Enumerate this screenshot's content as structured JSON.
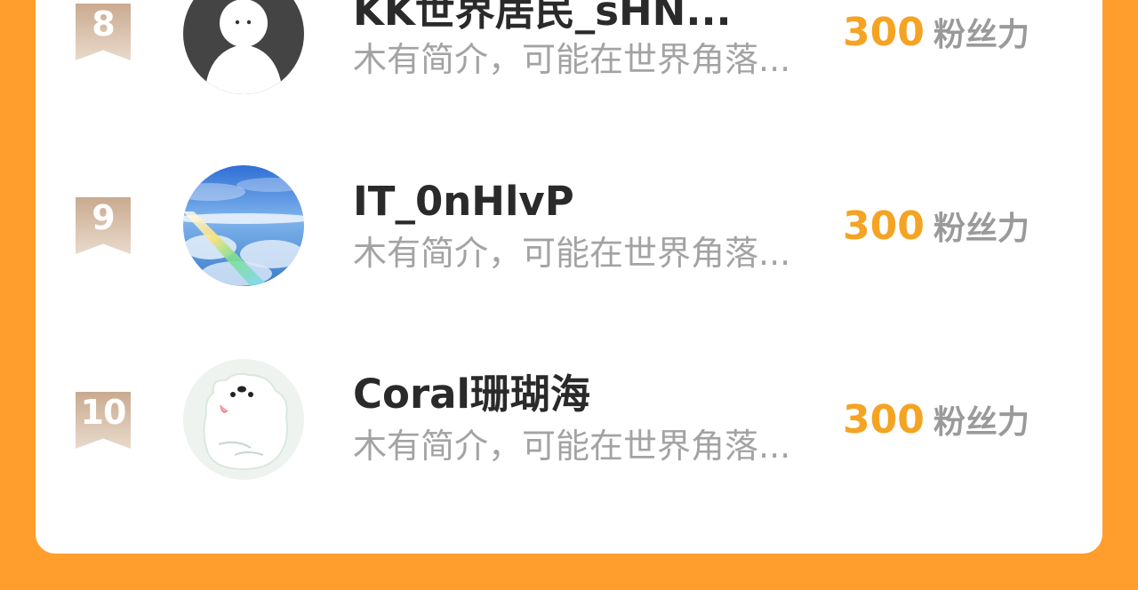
{
  "list": {
    "items": [
      {
        "rank": "8",
        "name": "KK世界居民_sHN...",
        "desc": "木有简介，可能在世界角落...",
        "score": "300",
        "unit": "粉丝力",
        "avatar": "default-person-avatar"
      },
      {
        "rank": "9",
        "name": "IT_0nHlvP",
        "desc": "木有简介，可能在世界角落...",
        "score": "300",
        "unit": "粉丝力",
        "avatar": "sky-clouds-rainbow-avatar"
      },
      {
        "rank": "10",
        "name": "Coral珊瑚海",
        "desc": "木有简介，可能在世界角落...",
        "score": "300",
        "unit": "粉丝力",
        "avatar": "polar-bear-avatar"
      }
    ]
  },
  "colors": {
    "background": "#FF9E2C",
    "card": "#FFFFFF",
    "score": "#F5A323",
    "name": "#2A2A2A",
    "desc": "#A3A3A3",
    "rank_badge": "#C9AA8F"
  }
}
